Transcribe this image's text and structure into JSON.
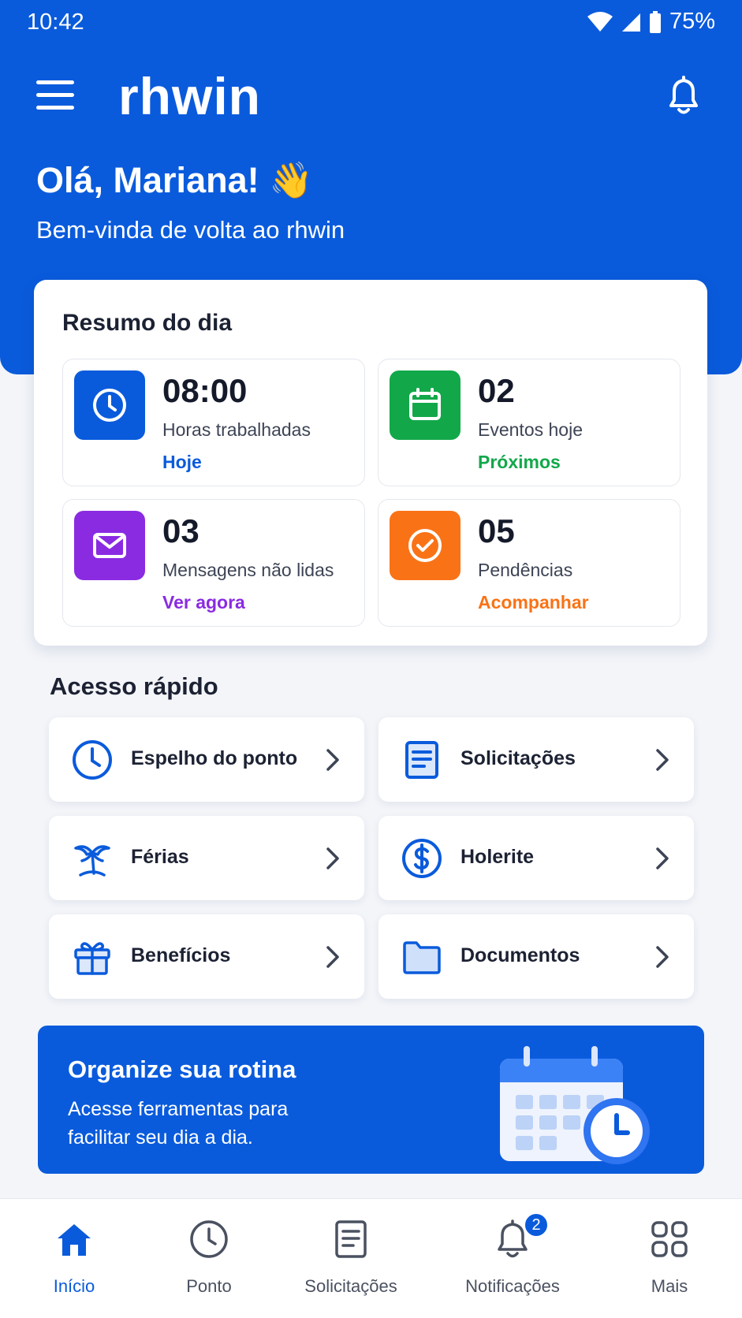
{
  "status_bar": {
    "time": "10:42",
    "battery": "75%"
  },
  "header": {
    "brand": "rhwin",
    "greeting": "Olá, Mariana! 👋",
    "subgreeting": "Bem-vinda de volta ao rhwin"
  },
  "summary": {
    "title": "Resumo do dia",
    "stats": [
      {
        "value": "08:00",
        "label": "Horas trabalhadas",
        "link": "Hoje",
        "icon": "clock-icon",
        "color": "#0a5bdc"
      },
      {
        "value": "02",
        "label": "Eventos hoje",
        "link": "Próximos",
        "icon": "calendar-icon",
        "color": "#12a84a"
      },
      {
        "value": "03",
        "label": "Mensagens não lidas",
        "link": "Ver agora",
        "icon": "mail-icon",
        "color": "#8a2be2"
      },
      {
        "value": "05",
        "label": "Pendências",
        "link": "Acompanhar",
        "icon": "check-circle-icon",
        "color": "#f97316"
      }
    ]
  },
  "quick_access": {
    "title": "Acesso rápido",
    "items": [
      {
        "label": "Espelho do ponto",
        "icon": "clock-icon"
      },
      {
        "label": "Solicitações",
        "icon": "document-icon"
      },
      {
        "label": "Férias",
        "icon": "palm-tree-icon"
      },
      {
        "label": "Holerite",
        "icon": "dollar-circle-icon"
      },
      {
        "label": "Benefícios",
        "icon": "gift-icon"
      },
      {
        "label": "Documentos",
        "icon": "folder-icon"
      }
    ]
  },
  "banner": {
    "title": "Organize sua rotina",
    "text": "Acesse ferramentas para facilitar seu dia a dia."
  },
  "bottom_nav": {
    "items": [
      {
        "label": "Início",
        "icon": "home-icon",
        "active": true
      },
      {
        "label": "Ponto",
        "icon": "clock-icon"
      },
      {
        "label": "Solicitações",
        "icon": "document-icon"
      },
      {
        "label": "Notificações",
        "icon": "bell-icon",
        "badge": "2"
      },
      {
        "label": "Mais",
        "icon": "grid-icon"
      }
    ]
  },
  "colors": {
    "primary": "#0a5bdc",
    "green": "#12a84a",
    "purple": "#8a2be2",
    "orange": "#f97316"
  }
}
